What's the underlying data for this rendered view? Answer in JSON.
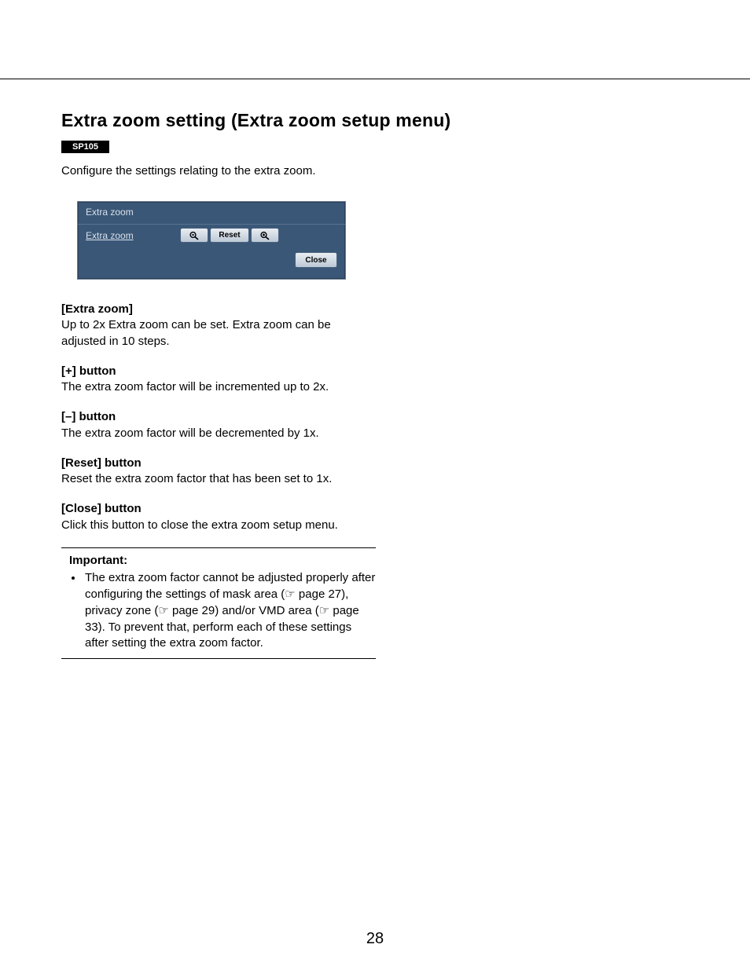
{
  "page_number": "28",
  "title": "Extra zoom setting (Extra zoom setup menu)",
  "model_badge": "SP105",
  "intro": "Configure the settings relating to the extra zoom.",
  "dialog": {
    "header": "Extra zoom",
    "row_label": "Extra zoom",
    "minus_button": "zoom-out-icon",
    "reset_button": "Reset",
    "plus_button": "zoom-in-icon",
    "close_button": "Close"
  },
  "sections": {
    "extra_zoom": {
      "head": "[Extra zoom]",
      "body": "Up to 2x Extra zoom can be set. Extra zoom can be adjusted in 10 steps."
    },
    "plus": {
      "head": "[+] button",
      "body": "The extra zoom factor will be incremented up to 2x."
    },
    "minus": {
      "head": "[–] button",
      "body": "The extra zoom factor will be decremented by 1x."
    },
    "reset": {
      "head": "[Reset] button",
      "body": "Reset the extra zoom factor that has been set to 1x."
    },
    "close": {
      "head": "[Close] button",
      "body": "Click this button to close the extra zoom setup menu."
    }
  },
  "important": {
    "head": "Important:",
    "item": "The extra zoom factor cannot be adjusted properly after configuring the settings of mask area (☞ page 27), privacy zone (☞ page 29) and/or VMD area (☞ page 33). To prevent that, perform each of these settings after setting the extra zoom factor."
  }
}
